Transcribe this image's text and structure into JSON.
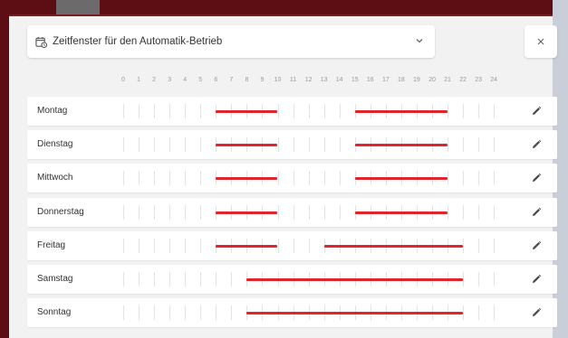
{
  "colors": {
    "accent_red": "#e0262b",
    "window_bar": "#5d0d14",
    "panel_bg": "#f2f2f3"
  },
  "dialog": {
    "title": "Zeitfenster für den Automatik-Betrieb",
    "title_icon": "calendar-clock-icon",
    "dropdown_icon": "chevron-down-icon",
    "close_icon": "close-icon"
  },
  "hours": [
    "0",
    "1",
    "2",
    "3",
    "4",
    "5",
    "6",
    "7",
    "8",
    "9",
    "10",
    "11",
    "12",
    "13",
    "14",
    "15",
    "16",
    "17",
    "18",
    "19",
    "20",
    "21",
    "22",
    "23",
    "24"
  ],
  "days": [
    {
      "label": "Montag",
      "windows": [
        [
          6,
          10
        ],
        [
          15,
          21
        ]
      ]
    },
    {
      "label": "Dienstag",
      "windows": [
        [
          6,
          10
        ],
        [
          15,
          21
        ]
      ]
    },
    {
      "label": "Mittwoch",
      "windows": [
        [
          6,
          10
        ],
        [
          15,
          21
        ]
      ]
    },
    {
      "label": "Donnerstag",
      "windows": [
        [
          6,
          10
        ],
        [
          15,
          21
        ]
      ]
    },
    {
      "label": "Freitag",
      "windows": [
        [
          6,
          10
        ],
        [
          13,
          22
        ]
      ]
    },
    {
      "label": "Samstag",
      "windows": [
        [
          8,
          22
        ]
      ]
    },
    {
      "label": "Sonntag",
      "windows": [
        [
          8,
          22
        ]
      ]
    }
  ],
  "row_action_icon": "pencil-icon"
}
